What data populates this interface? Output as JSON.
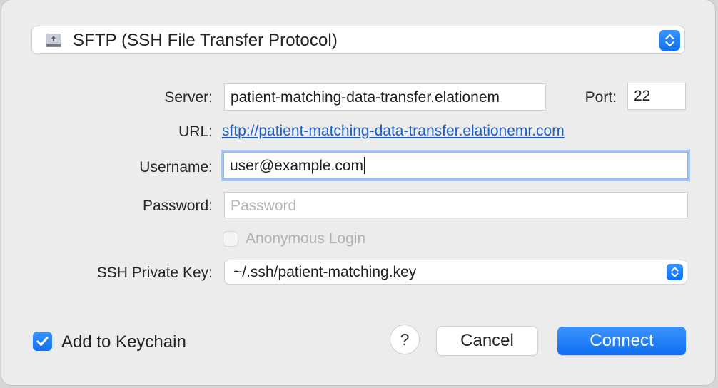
{
  "protocol": {
    "selected": "SFTP (SSH File Transfer Protocol)",
    "icon": "network-drive-icon"
  },
  "form": {
    "server_label": "Server:",
    "server_value": "patient-matching-data-transfer.elationem",
    "port_label": "Port:",
    "port_value": "22",
    "url_label": "URL:",
    "url_value": "sftp://patient-matching-data-transfer.elationemr.com",
    "username_label": "Username:",
    "username_value": "user@example.com",
    "password_label": "Password:",
    "password_placeholder": "Password",
    "anonymous_label": "Anonymous Login",
    "anonymous_checked": false,
    "ssh_key_label": "SSH Private Key:",
    "ssh_key_value": "~/.ssh/patient-matching.key"
  },
  "footer": {
    "keychain_label": "Add to Keychain",
    "keychain_checked": true,
    "help_label": "?",
    "cancel_label": "Cancel",
    "connect_label": "Connect"
  },
  "colors": {
    "accent": "#1a7cf5",
    "link": "#1a5ec9",
    "background": "#ececec"
  }
}
